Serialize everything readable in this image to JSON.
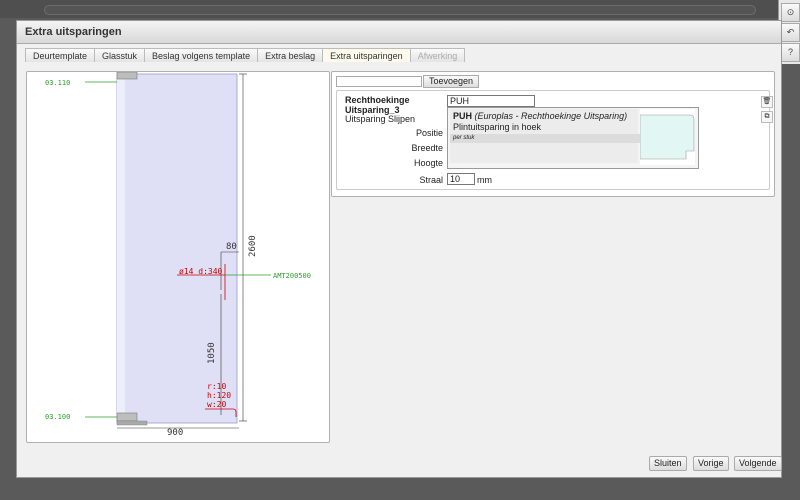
{
  "window": {
    "title": "Extra uitsparingen"
  },
  "side_buttons": [
    {
      "glyph": "⊙"
    },
    {
      "glyph": "↶"
    },
    {
      "glyph": "?"
    }
  ],
  "tabs": [
    {
      "label": "Deurtemplate"
    },
    {
      "label": "Glasstuk"
    },
    {
      "label": "Beslag volgens template"
    },
    {
      "label": "Extra beslag"
    },
    {
      "label": "Extra uitsparingen"
    },
    {
      "label": "Afwerking"
    }
  ],
  "drawing": {
    "labels": {
      "top_ref": "03.110",
      "bottom_ref": "03.100",
      "height": "2600",
      "width": "900",
      "offset": "80",
      "hole": "ø14 d:340",
      "part": "AMT200500",
      "position": "1050",
      "cut_r": "r:10",
      "cut_h": "h:120",
      "cut_w": "w:20"
    },
    "colors": {
      "ref": "#2aa02a",
      "dim": "#cc0000",
      "glass": "#dfe0f6"
    }
  },
  "add_section": {
    "input_value": "",
    "add_button": "Toevoegen"
  },
  "item": {
    "title": "Rechthoekinge Uitsparing_3",
    "subtitle": "Uitsparing Slijpen",
    "code_value": "PUH",
    "fields": {
      "positie": "Positie",
      "breedte": "Breedte",
      "hoogte": "Hoogte",
      "straal": "Straal",
      "straal_value": "10",
      "straal_unit": "mm"
    }
  },
  "dropdown": {
    "code": "PUH",
    "detail": "(Europlas - Rechthoekinge Uitsparing)",
    "description": "Plintuitsparing in hoek",
    "unit": "per stuk"
  },
  "actions": {
    "delete_icon": "🗑",
    "copy_icon": "⧉"
  },
  "footer": {
    "close": "Sluiten",
    "prev": "Vorige",
    "next": "Volgende"
  }
}
